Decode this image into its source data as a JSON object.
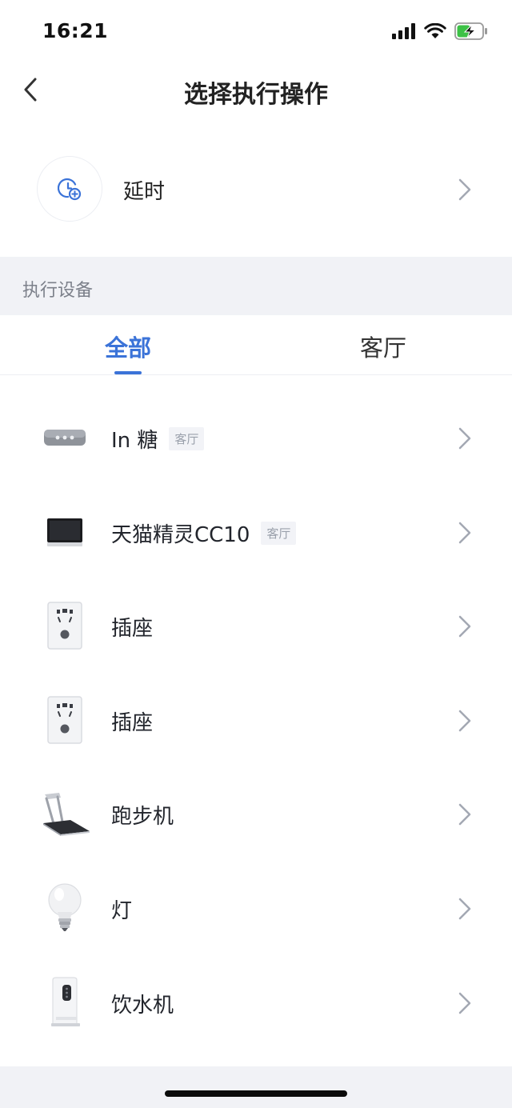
{
  "status_bar": {
    "time": "16:21",
    "icons": [
      "signal-icon",
      "wifi-icon",
      "battery-charging-icon"
    ],
    "battery_color": "#3cc146"
  },
  "nav": {
    "title": "选择执行操作",
    "back_icon": "chevron-left-icon"
  },
  "delay": {
    "label": "延时",
    "icon": "clock-add-icon"
  },
  "section": {
    "title": "执行设备"
  },
  "tabs": [
    {
      "label": "全部",
      "active": true
    },
    {
      "label": "客厅",
      "active": false
    }
  ],
  "devices": [
    {
      "name": "In 糖",
      "room": "客厅",
      "icon": "remote-hub-icon"
    },
    {
      "name": "天猫精灵CC10",
      "room": "客厅",
      "icon": "smart-screen-icon"
    },
    {
      "name": "插座",
      "room": "",
      "icon": "socket-icon"
    },
    {
      "name": "插座",
      "room": "",
      "icon": "socket-icon"
    },
    {
      "name": "跑步机",
      "room": "",
      "icon": "treadmill-icon"
    },
    {
      "name": "灯",
      "room": "",
      "icon": "light-bulb-icon"
    },
    {
      "name": "饮水机",
      "room": "",
      "icon": "water-dispenser-icon"
    }
  ],
  "colors": {
    "accent": "#3b73d8",
    "section_bg": "#f1f2f6",
    "chevron": "#a3a8b3"
  }
}
